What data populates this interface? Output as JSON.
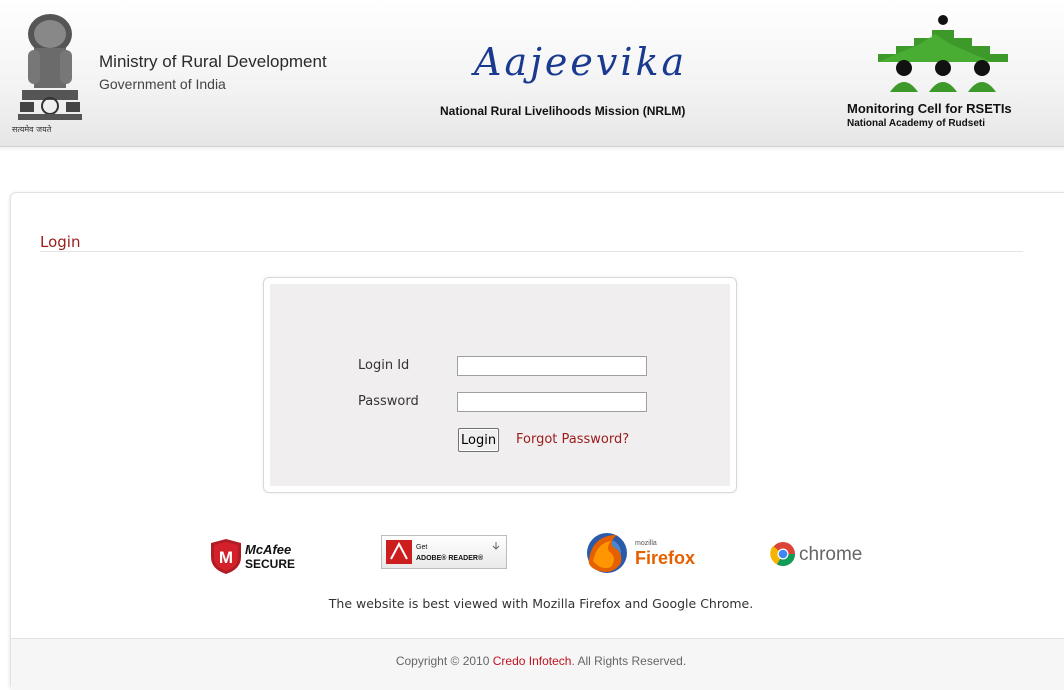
{
  "header": {
    "emblem_caption": "सत्यमेव जयते",
    "ministry_title": "Ministry of Rural Development",
    "ministry_subtitle": "Government of India",
    "program_name": "Aajeevika",
    "program_subtitle": "National Rural Livelihoods Mission (NRLM)",
    "cell_title": "Monitoring Cell for RSETIs",
    "cell_subtitle": "National Academy of Rudseti"
  },
  "login": {
    "heading": "Login",
    "login_id_label": "Login Id",
    "password_label": "Password",
    "login_id_value": "",
    "password_value": "",
    "login_button": "Login",
    "forgot_link": "Forgot Password?"
  },
  "badges": {
    "mcafee_line1": "McAfee",
    "mcafee_line2": "SECURE",
    "adobe_line1": "Get",
    "adobe_line2": "ADOBE® READER®",
    "firefox_small": "mozilla",
    "firefox_name": "Firefox",
    "chrome_name": "chrome"
  },
  "best_viewed_text": "The website is best viewed with Mozilla Firefox and Google Chrome.",
  "footer": {
    "copyright_prefix": "Copyright © 2010 ",
    "company": "Credo Infotech",
    "copyright_suffix": ". All Rights Reserved."
  },
  "colors": {
    "accent": "#9b1c1c",
    "aajeevika_blue": "#1a3a8f",
    "rseti_green": "#3d9a2a"
  }
}
